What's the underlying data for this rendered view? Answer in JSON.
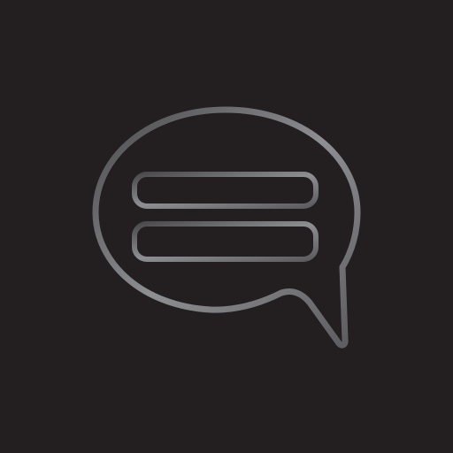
{
  "icon": {
    "name": "chat-bubble-icon",
    "background_color": "#231f20",
    "stroke_colors": {
      "start": "#4a4a4c",
      "mid": "#8e8f92",
      "end": "#5c5c5f"
    },
    "line_count": 2
  }
}
